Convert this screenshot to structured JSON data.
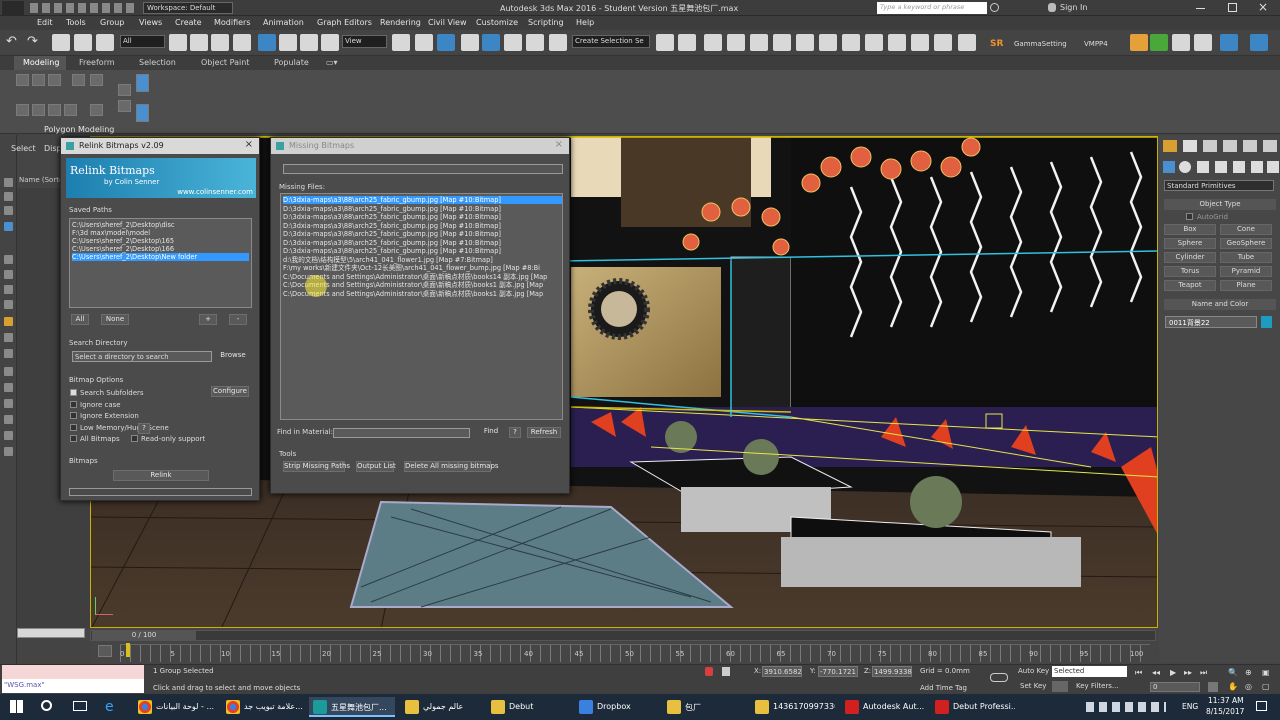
{
  "title_bar": {
    "workspace": "Workspace: Default",
    "app_title": "Autodesk 3ds Max 2016 - Student Version  五星舞池包厂.max",
    "search_placeholder": "Type a keyword or phrase",
    "sign_in": "Sign In"
  },
  "menu": [
    "Edit",
    "Tools",
    "Group",
    "Views",
    "Create",
    "Modifiers",
    "Animation",
    "Graph Editors",
    "Rendering",
    "Civil View",
    "Customize",
    "Scripting",
    "Help"
  ],
  "toolbar": {
    "filter": "All",
    "view": "View",
    "selection_set": "Create Selection Se",
    "sr": "SR",
    "gamma": "GammaSetting",
    "vmpp": "VMPP4"
  },
  "ribbon": {
    "tabs": [
      "Modeling",
      "Freeform",
      "Selection",
      "Object Paint",
      "Populate"
    ],
    "panel_label": "Polygon Modeling"
  },
  "scene_explorer": {
    "select": "Select",
    "display": "Disp",
    "name_col": "Name (Sorte"
  },
  "relink": {
    "title": "Relink Bitmaps v2.09",
    "banner_title": "Relink Bitmaps",
    "banner_sub": "by Colin Senner",
    "banner_url": "www.colinsenner.com",
    "saved_paths_label": "Saved Paths",
    "saved_paths": [
      "C:\\Users\\sheref_2\\Desktop\\disc",
      "F:\\3d max\\model\\model",
      "C:\\Users\\sheref_2\\Desktop\\165",
      "C:\\Users\\sheref_2\\Desktop\\166",
      "C:\\Users\\sheref_2\\Desktop\\New folder"
    ],
    "all": "All",
    "none": "None",
    "plus": "+",
    "minus": "-",
    "search_dir_label": "Search Directory",
    "search_dir_value": "Select a directory to search",
    "browse": "Browse",
    "options_label": "Bitmap Options",
    "opt_subfolders": "Search Subfolders",
    "configure": "Configure",
    "opt_ignore_case": "Ignore case",
    "opt_ignore_ext": "Ignore Extension",
    "opt_low_mem": "Low Memory/Huge Scene",
    "help": "?",
    "opt_all_bitmaps": "All Bitmaps",
    "opt_readonly": "Read-only support",
    "bitmaps_label": "Bitmaps",
    "relink_btn": "Relink"
  },
  "missing": {
    "title": "Missing Bitmaps",
    "files_label": "Missing Files:",
    "files": [
      "D:\\3dxia-maps\\a3\\88\\arch25_fabric_gbump.jpg      [Map #10:Bitmap]",
      "D:\\3dxia-maps\\a3\\88\\arch25_fabric_gbump.jpg      [Map #10:Bitmap]",
      "D:\\3dxia-maps\\a3\\88\\arch25_fabric_gbump.jpg      [Map #10:Bitmap]",
      "D:\\3dxia-maps\\a3\\88\\arch25_fabric_gbump.jpg      [Map #10:Bitmap]",
      "D:\\3dxia-maps\\a3\\88\\arch25_fabric_gbump.jpg      [Map #10:Bitmap]",
      "D:\\3dxia-maps\\a3\\88\\arch25_fabric_gbump.jpg      [Map #10:Bitmap]",
      "D:\\3dxia-maps\\a3\\88\\arch25_fabric_gbump.jpg      [Map #10:Bitmap]",
      "d:\\我的文档\\结构模型\\5\\arch41_041_flower1.jpg     [Map #7:Bitmap]",
      "F:\\my works\\新建文件夹\\Oct-12长美图\\arch41_041_flower_bump.jpg     [Map #8:Bi",
      "C:\\Documents and Settings\\Administrator\\桌面\\新稿点材质\\books14 副本.jpg    [Map",
      "C:\\Documents and Settings\\Administrator\\桌面\\新稿点材质\\books1 副本.jpg    [Map",
      "C:\\Documents and Settings\\Administrator\\桌面\\新稿点材质\\books1 副本.jpg    [Map"
    ],
    "find_material_label": "Find in Material:",
    "find": "Find",
    "help": "?",
    "refresh": "Refresh",
    "tools_label": "Tools",
    "strip": "Strip Missing Paths",
    "output": "Output List",
    "delete": "Delete All missing bitmaps"
  },
  "command_panel": {
    "dropdown": "Standard Primitives",
    "object_type": "Object Type",
    "autogrid": "AutoGrid",
    "buttons": [
      "Box",
      "Cone",
      "Sphere",
      "GeoSphere",
      "Cylinder",
      "Tube",
      "Torus",
      "Pyramid",
      "Teapot",
      "Plane"
    ],
    "name_color": "Name and Color",
    "name_value": "0011背景22"
  },
  "timeline": {
    "frame": "0 / 100",
    "ticks": [
      "0",
      "5",
      "10",
      "15",
      "20",
      "25",
      "30",
      "35",
      "40",
      "45",
      "50",
      "55",
      "60",
      "65",
      "70",
      "75",
      "80",
      "85",
      "90",
      "95",
      "100"
    ]
  },
  "status": {
    "maxscript": "\"WSG.max\"",
    "selected": "1 Group Selected",
    "prompt": "Click and drag to select and move objects",
    "x": "3910.6582",
    "y": "-770.1721",
    "z": "1499.9338",
    "grid": "Grid = 0.0mm",
    "add_time_tag": "Add Time Tag",
    "auto_key": "Auto Key",
    "set_key": "Set Key",
    "selected_mode": "Selected",
    "key_filters": "Key Filters...",
    "frame_value": "0"
  },
  "taskbar": {
    "items": [
      "لوحة البيانات - ...",
      "علامة تبويب جد...",
      "五星舞池包厂...",
      "عالم جمولي",
      "Debut",
      "Dropbox",
      "包厂",
      "14361709973301...",
      "Autodesk Aut...",
      "Debut Professi..."
    ],
    "lang": "ENG",
    "time": "11:37 AM",
    "date": "8/15/2017"
  }
}
